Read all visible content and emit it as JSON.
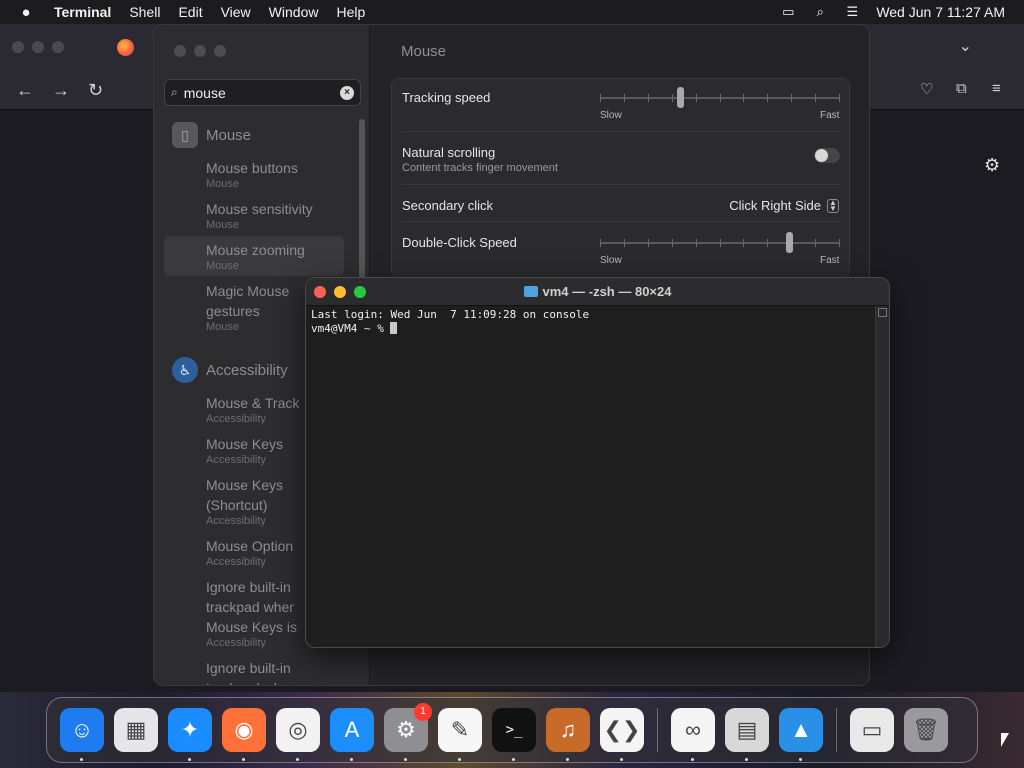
{
  "menubar": {
    "app_name": "Terminal",
    "items": [
      "Shell",
      "Edit",
      "View",
      "Window",
      "Help"
    ],
    "clock": "Wed Jun 7  11:27 AM",
    "icons": [
      "screen-mirroring-icon",
      "spotlight-search-icon",
      "control-center-icon"
    ]
  },
  "settings": {
    "search": {
      "value": "mouse"
    },
    "sidebar": {
      "mouse_heading": "Mouse",
      "accessibility_heading": "Accessibility",
      "items": [
        {
          "title": "Mouse buttons",
          "sub": "Mouse"
        },
        {
          "title": "Mouse sensitivity",
          "sub": "Mouse"
        },
        {
          "title": "Mouse zooming",
          "sub": "Mouse"
        },
        {
          "title": "Magic Mouse",
          "title2": "gestures",
          "sub": "Mouse"
        },
        {
          "title": "Mouse & Track",
          "sub": "Accessibility"
        },
        {
          "title": "Mouse Keys",
          "sub": "Accessibility"
        },
        {
          "title": "Mouse Keys",
          "title2": "(Shortcut)",
          "sub": "Accessibility"
        },
        {
          "title": "Mouse Option",
          "sub": "Accessibility"
        },
        {
          "title": "Ignore built-in",
          "title2": "trackpad wher",
          "title3": "Mouse Keys is",
          "sub": "Accessibility"
        },
        {
          "title": "Ignore built-in",
          "title2": "trackpad when"
        }
      ]
    },
    "content": {
      "title": "Mouse",
      "tracking_speed": {
        "label": "Tracking speed",
        "min_label": "Slow",
        "max_label": "Fast",
        "value": 0.33
      },
      "natural_scrolling": {
        "label": "Natural scrolling",
        "sub": "Content tracks finger movement",
        "enabled": false
      },
      "secondary_click": {
        "label": "Secondary click",
        "value": "Click Right Side"
      },
      "double_click_speed": {
        "label": "Double-Click Speed",
        "min_label": "Slow",
        "max_label": "Fast",
        "value": 0.8
      }
    }
  },
  "terminal": {
    "title": "vm4 — -zsh — 80×24",
    "lines": [
      "Last login: Wed Jun  7 11:09:28 on console",
      "vm4@VM4 ~ % "
    ]
  },
  "dock": {
    "apps": [
      {
        "name": "finder-icon",
        "glyph": "☺",
        "bg": "#1e7bf0"
      },
      {
        "name": "launchpad-icon",
        "glyph": "▦",
        "bg": "#e6e6ea"
      },
      {
        "name": "safari-icon",
        "glyph": "✦",
        "bg": "#1a8cff"
      },
      {
        "name": "firefox-icon",
        "glyph": "◉",
        "bg": "#ff7139"
      },
      {
        "name": "chrome-icon",
        "glyph": "◎",
        "bg": "#f2f2f2"
      },
      {
        "name": "app-store-icon",
        "glyph": "A",
        "bg": "#1c8ef9"
      },
      {
        "name": "system-settings-icon",
        "glyph": "⚙",
        "bg": "#8e8e93",
        "badge": "1"
      },
      {
        "name": "textedit-icon",
        "glyph": "✎",
        "bg": "#f7f7f7"
      },
      {
        "name": "terminal-icon",
        "glyph": ">_",
        "bg": "#111111"
      },
      {
        "name": "garageband-icon",
        "glyph": "♫",
        "bg": "#c76a2a"
      },
      {
        "name": "vscode-icon",
        "glyph": "❮❯",
        "bg": "#f5f5f5"
      },
      {
        "name": "visual-studio-icon",
        "glyph": "∞",
        "bg": "#f5f5f5"
      },
      {
        "name": "calculator-icon",
        "glyph": "▤",
        "bg": "#d8d8d8"
      },
      {
        "name": "keynote-icon",
        "glyph": "▲",
        "bg": "#2a8fe6"
      },
      {
        "name": "preview-icon",
        "glyph": "▭",
        "bg": "#e9e9e9"
      },
      {
        "name": "trash-icon",
        "glyph": "🗑",
        "bg": "#9a9a9e"
      }
    ]
  }
}
